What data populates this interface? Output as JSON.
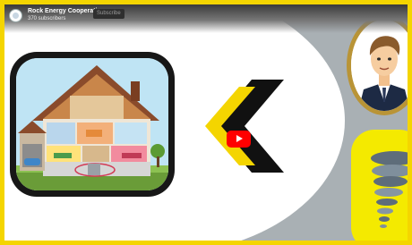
{
  "channel": {
    "name": "Rock Energy Cooperative",
    "subscribers": "370 subscribers",
    "subscribe_label": "Subscribe"
  },
  "player": {
    "play_icon": "play-icon"
  },
  "colors": {
    "frame": "#f4d500",
    "background": "#a9b0b4",
    "play_button": "#ff0000",
    "arrow_yellow": "#f4d500",
    "arrow_black": "#111111"
  },
  "icons": [
    "channel-avatar-icon",
    "play-icon"
  ]
}
